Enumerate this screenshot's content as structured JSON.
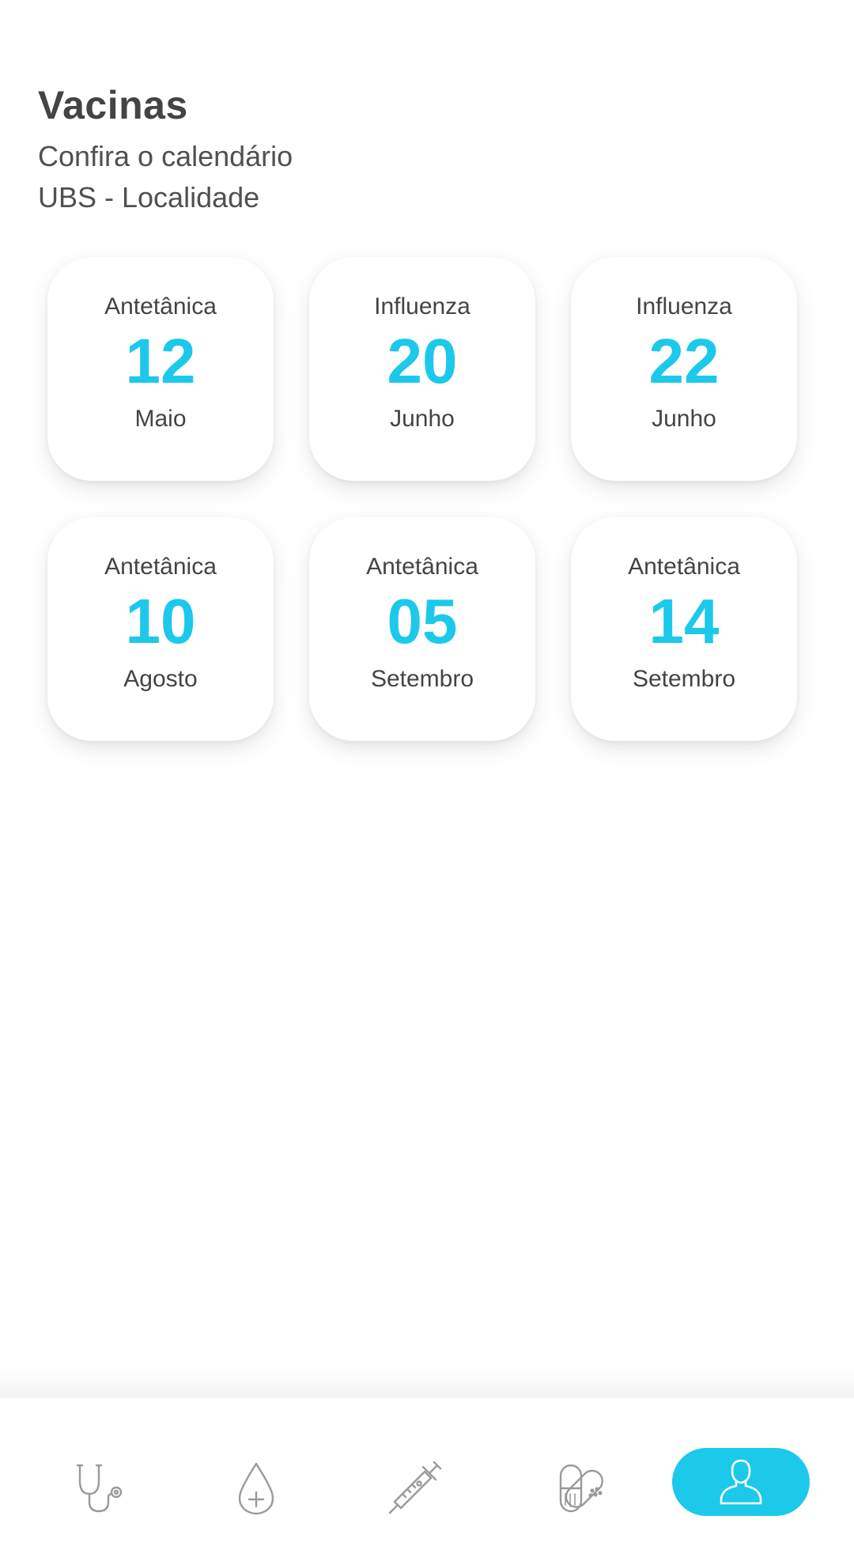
{
  "header": {
    "title": "Vacinas",
    "subtitle": "Confira o calendário",
    "location": "UBS - Localidade"
  },
  "vaccines": [
    {
      "name": "Antetânica",
      "day": "12",
      "month": "Maio"
    },
    {
      "name": "Influenza",
      "day": "20",
      "month": "Junho"
    },
    {
      "name": "Influenza",
      "day": "22",
      "month": "Junho"
    },
    {
      "name": "Antetânica",
      "day": "10",
      "month": "Agosto"
    },
    {
      "name": "Antetânica",
      "day": "05",
      "month": "Setembro"
    },
    {
      "name": "Antetânica",
      "day": "14",
      "month": "Setembro"
    }
  ],
  "nav": {
    "items": [
      {
        "icon": "stethoscope-icon"
      },
      {
        "icon": "blood-drop-icon"
      },
      {
        "icon": "syringe-icon"
      },
      {
        "icon": "pill-bandage-icon"
      },
      {
        "icon": "user-icon",
        "active": true
      }
    ]
  },
  "colors": {
    "accent": "#1cc9ea",
    "text": "#444444",
    "icon": "#9a9a9a"
  }
}
